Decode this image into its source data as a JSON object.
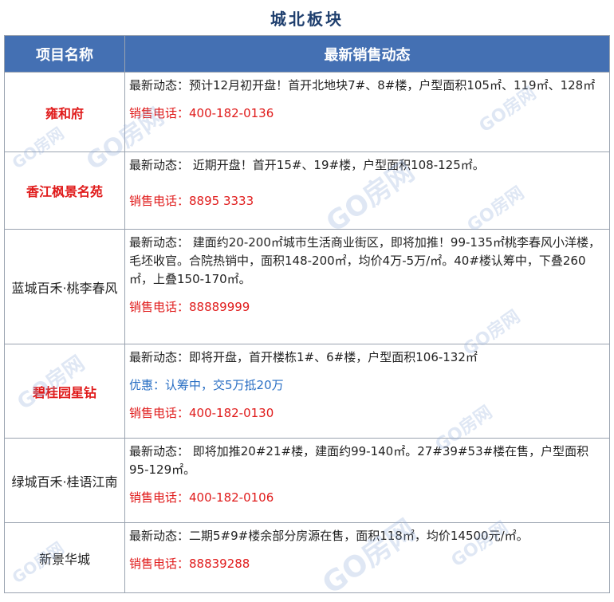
{
  "page": {
    "title": "城北板块"
  },
  "table": {
    "headers": {
      "project": "项目名称",
      "news": "最新销售动态"
    },
    "rows": [
      {
        "name": "雍和府",
        "highlight": true,
        "news": "最新动态：预计12月初开盘！首开北地块7#、8#楼，户型面积105㎡、119㎡、128㎡",
        "phone": "销售电话：400-182-0136"
      },
      {
        "name": "香江枫景名苑",
        "highlight": true,
        "news": "最新动态： 近期开盘！首开15#、19#楼，户型面积108-125㎡。",
        "phone": "销售电话：8895 3333"
      },
      {
        "name": "蓝城百禾·桃李春风",
        "highlight": false,
        "news": "最新动态： 建面约20-200㎡城市生活商业街区，即将加推！99-135㎡桃李春风小洋楼，毛坯收官。合院热销中，面积148-200㎡，均价4万-5万/㎡。40#楼认筹中，下叠260㎡，上叠150-170㎡。",
        "phone": "销售电话：88889999"
      },
      {
        "name": "碧桂园星钻",
        "highlight": true,
        "news": "最新动态：即将开盘，首开楼栋1#、6#楼，户型面积106-132㎡",
        "promo": "优惠：认筹中，交5万抵20万",
        "phone": "销售电话：400-182-0130"
      },
      {
        "name": "绿城百禾·桂语江南",
        "highlight": false,
        "news": "最新动态： 即将加推20#21#楼，建面约99-140㎡。27#39#53#楼在售，户型面积95-129㎡。",
        "phone": "销售电话：400-182-0106"
      },
      {
        "name": "新景华城",
        "highlight": false,
        "news": "最新动态：二期5#9#楼余部分房源在售，面积118㎡，均价14500元/㎡。",
        "phone": "销售电话：88839288"
      }
    ]
  },
  "watermark": {
    "text": "GO房网"
  }
}
